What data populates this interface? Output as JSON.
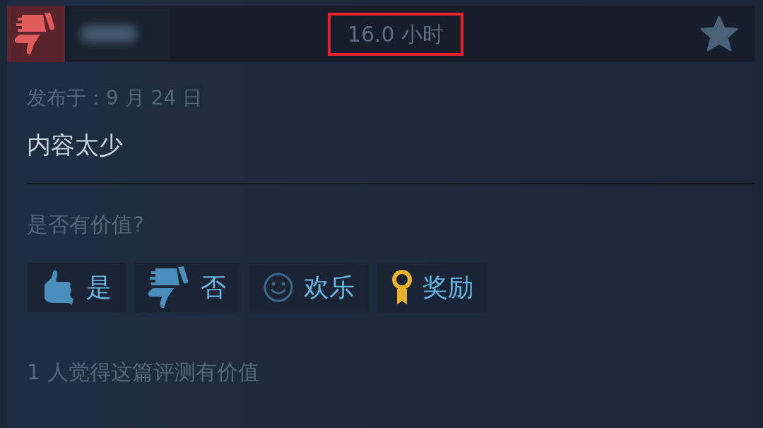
{
  "review": {
    "recommended": false,
    "playtime": {
      "text": "16.0 小时",
      "highlighted": true
    },
    "posted": "发布于：9 月 24 日",
    "body": "内容太少",
    "helpful_prompt": "是否有价值?",
    "buttons": [
      {
        "kind": "thumb-up",
        "label": "是"
      },
      {
        "kind": "thumb-down",
        "label": "否"
      },
      {
        "kind": "smile",
        "label": "欢乐"
      },
      {
        "kind": "award",
        "label": "奖励"
      }
    ],
    "helpful_count": "1 人觉得这篇评测有价值"
  }
}
